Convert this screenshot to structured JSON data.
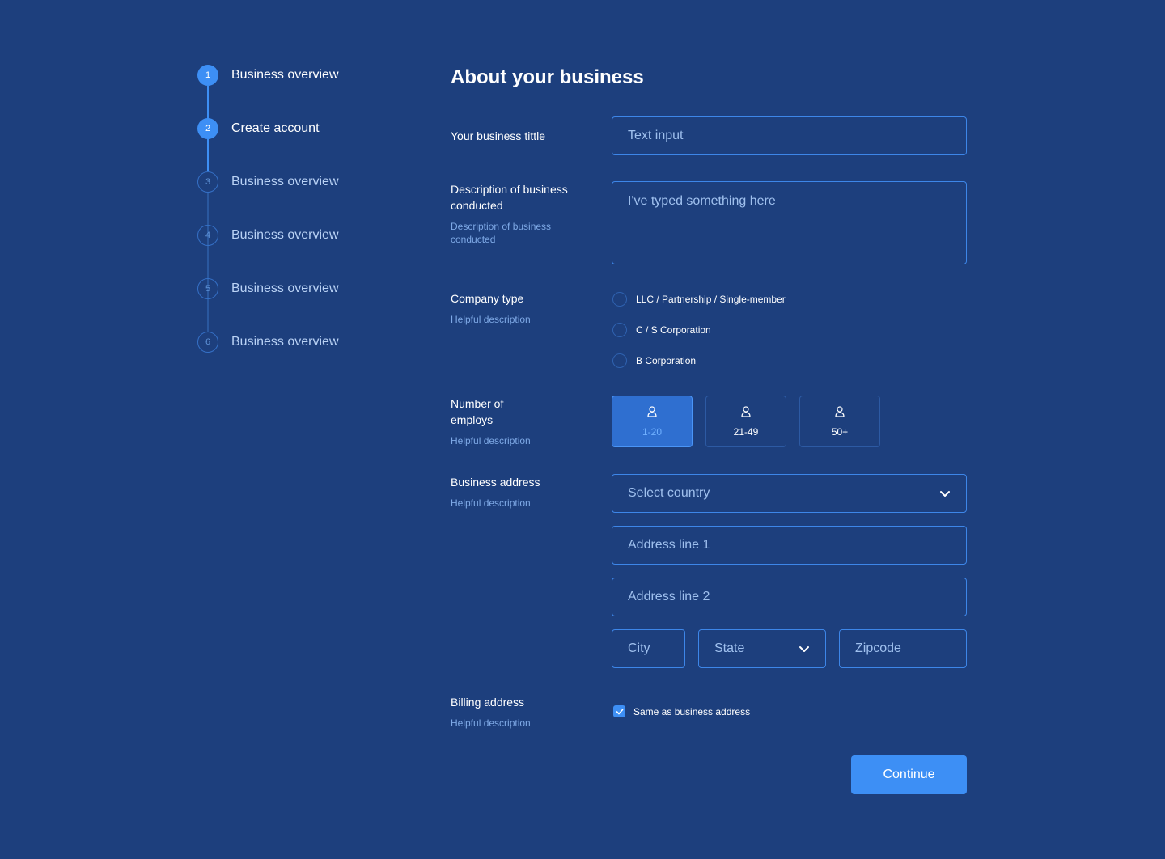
{
  "colors": {
    "background": "#1d3f7d",
    "accent": "#3d8ff5",
    "border": "#3d86e8",
    "muted_text": "#7ea9e6"
  },
  "stepper": {
    "steps": [
      {
        "number": "1",
        "label": "Business overview",
        "state": "completed"
      },
      {
        "number": "2",
        "label": "Create account",
        "state": "current"
      },
      {
        "number": "3",
        "label": "Business overview",
        "state": "upcoming"
      },
      {
        "number": "4",
        "label": "Business overview",
        "state": "upcoming"
      },
      {
        "number": "5",
        "label": "Business overview",
        "state": "upcoming"
      },
      {
        "number": "6",
        "label": "Business overview",
        "state": "upcoming"
      }
    ]
  },
  "form": {
    "title": "About your business",
    "business_title": {
      "label": "Your business tittle",
      "placeholder": "Text input",
      "value": ""
    },
    "description": {
      "label": "Description of business conducted",
      "help": "Description of business conducted",
      "value": "I've typed something here"
    },
    "company_type": {
      "label": "Company type",
      "help": "Helpful description",
      "options": [
        {
          "label": "LLC / Partnership / Single-member",
          "selected": false
        },
        {
          "label": "C / S Corporation",
          "selected": false
        },
        {
          "label": "B Corporation",
          "selected": false
        }
      ]
    },
    "employees": {
      "label": "Number of employs",
      "help": "Helpful description",
      "options": [
        {
          "label": "1-20",
          "icon": "user-icon",
          "selected": true
        },
        {
          "label": "21-49",
          "icon": "user-icon",
          "selected": false
        },
        {
          "label": "50+",
          "icon": "user-icon",
          "selected": false
        }
      ]
    },
    "business_address": {
      "label": "Business address",
      "help": "Helpful description",
      "country_placeholder": "Select country",
      "line1_placeholder": "Address line 1",
      "line2_placeholder": "Address line 2",
      "city_placeholder": "City",
      "state_placeholder": "State",
      "zip_placeholder": "Zipcode"
    },
    "billing_address": {
      "label": "Billing address",
      "help": "Helpful description",
      "checkbox_label": "Same as business address",
      "checked": true
    },
    "continue_label": "Continue"
  }
}
